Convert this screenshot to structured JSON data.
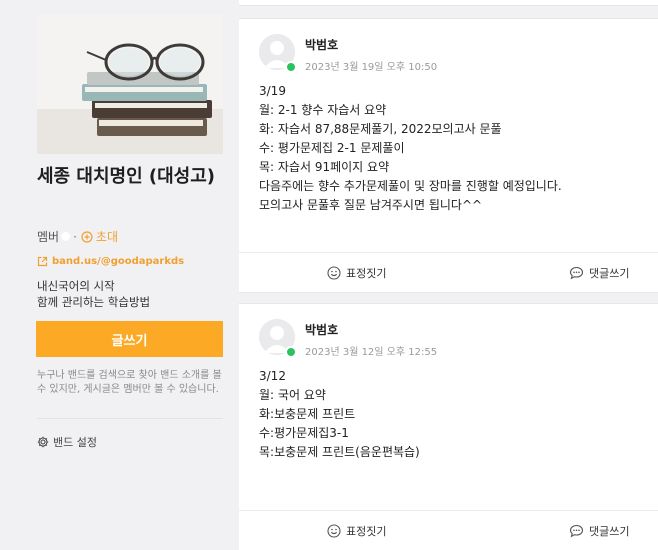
{
  "sidebar": {
    "band_name": "세종 대치명인 (대성고)",
    "member_label": "멤버",
    "invite_label": "초대",
    "link_text": "band.us/@goodaparkds",
    "description_lines": [
      "내신국어의 시작",
      "함께 관리하는 학습방법"
    ],
    "write_button": "글쓰기",
    "notice": "누구나 밴드를 검색으로 찾아 밴드 소개를 볼 수 있지만, 게시글은 멤버만 볼 수 있습니다.",
    "settings_label": "밴드 설정"
  },
  "posts": [
    {
      "author": "박범호",
      "date": "2023년 3월 19일 오후 10:50",
      "lines": [
        "3/19",
        "월: 2-1 향수 자습서 요약",
        "화: 자습서 87,88문제풀기, 2022모의고사 문풀",
        "수: 평가문제집 2-1 문제풀이",
        "목: 자습서 91페이지 요약",
        "다음주에는 향수 추가문제풀이 및 장마를 진행할 예정입니다.",
        "모의고사 문풀후 질문 남겨주시면 됩니다^^"
      ],
      "react_label": "표정짓기",
      "comment_label": "댓글쓰기"
    },
    {
      "author": "박범호",
      "date": "2023년 3월 12일 오후 12:55",
      "lines": [
        "3/12",
        "월: 국어 요약",
        "화:보충문제 프린트",
        "수:평가문제집3-1",
        "목:보충문제 프린트(음운편복습)"
      ],
      "react_label": "표정짓기",
      "comment_label": "댓글쓰기"
    }
  ],
  "icons": {
    "invite": "plus-circle-icon",
    "link": "external-link-icon",
    "settings": "gear-icon",
    "react": "smiley-icon",
    "comment": "speech-bubble-icon"
  },
  "colors": {
    "accent": "#fcaa25",
    "link": "#f0a030",
    "online": "#2bc35f"
  }
}
